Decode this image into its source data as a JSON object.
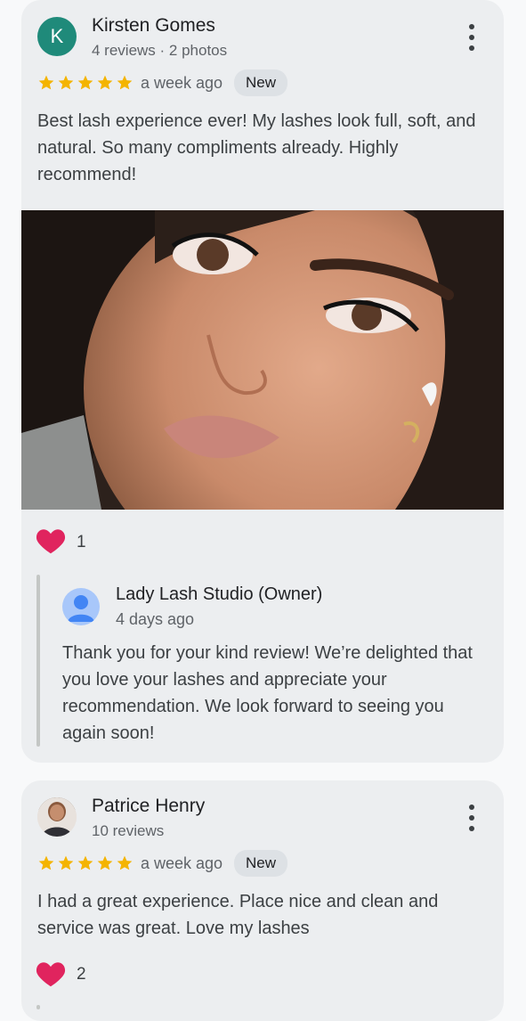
{
  "reviews": [
    {
      "avatar_letter": "K",
      "name": "Kirsten Gomes",
      "meta": "4 reviews · 2 photos",
      "rating": 5,
      "time": "a week ago",
      "badge": "New",
      "text": "Best lash experience ever! My lashes look full, soft, and natural. So many compliments already. Highly recommend!",
      "likes": "1",
      "reply": {
        "owner": "Lady Lash Studio (Owner)",
        "time": "4 days ago",
        "text": "Thank you for your kind review! We’re delighted that you love your lashes and appreciate your recommendation. We look forward to seeing you again soon!"
      }
    },
    {
      "name": "Patrice Henry",
      "meta": "10 reviews",
      "rating": 5,
      "time": "a week ago",
      "badge": "New",
      "text": "I had a great experience. Place nice and clean and service was great. Love my lashes",
      "likes": "2"
    }
  ],
  "colors": {
    "star": "#f4b400",
    "heart": "#e0245e",
    "avatar_k": "#1f8a7a",
    "card": "#eceef0"
  }
}
